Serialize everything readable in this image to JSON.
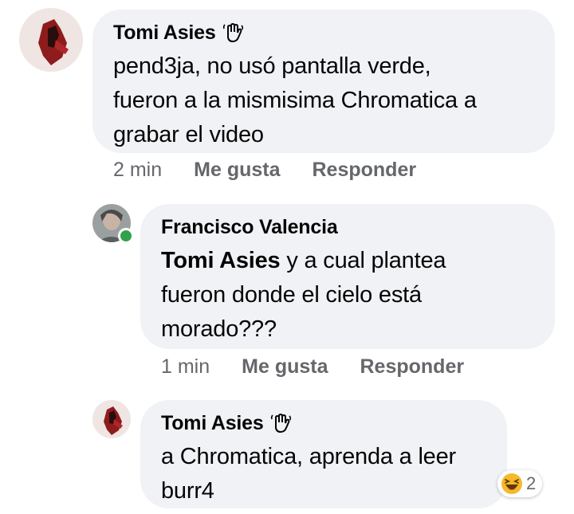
{
  "comments": [
    {
      "author": "Tomi Asies",
      "badge_icon": "wave-hand-icon",
      "text_lines": [
        "pend3ja, no usó pantalla verde,",
        "fueron a la mismisima Chromatica a",
        "grabar el video"
      ],
      "time": "2 min",
      "like_label": "Me gusta",
      "reply_label": "Responder"
    },
    {
      "author": "Francisco Valencia",
      "mention": "Tomi Asies",
      "text_first_rest": " y a cual plantea",
      "text_lines": [
        "fueron donde el cielo está",
        "morado???"
      ],
      "time": "1 min",
      "like_label": "Me gusta",
      "reply_label": "Responder",
      "online": true
    },
    {
      "author": "Tomi Asies",
      "badge_icon": "wave-hand-icon",
      "text_lines": [
        "a Chromatica, aprenda a leer",
        "burr4"
      ],
      "reaction": {
        "icon": "haha-reaction-icon",
        "count": "2"
      }
    }
  ],
  "colors": {
    "bubble": "#f0f2f5",
    "meta_text": "#65676b",
    "online": "#31a24c",
    "haha": "#f7b928"
  }
}
